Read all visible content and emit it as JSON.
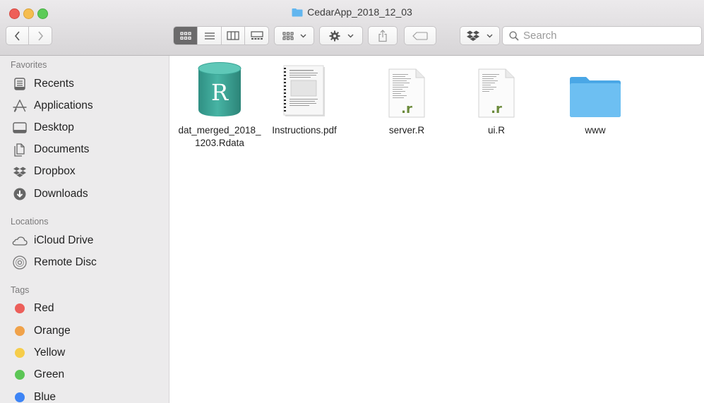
{
  "window": {
    "title": "CedarApp_2018_12_03"
  },
  "toolbar": {
    "search_placeholder": "Search",
    "icons": [
      "chevron-left-icon",
      "chevron-right-icon",
      "icon-view-icon",
      "list-view-icon",
      "column-view-icon",
      "gallery-view-icon",
      "group-by-icon",
      "gear-icon",
      "share-icon",
      "tag-icon",
      "dropbox-icon",
      "search-icon"
    ]
  },
  "sidebar": {
    "favorites_heading": "Favorites",
    "favorites": [
      {
        "label": "Recents",
        "icon": "recents-icon"
      },
      {
        "label": "Applications",
        "icon": "applications-icon"
      },
      {
        "label": "Desktop",
        "icon": "desktop-icon"
      },
      {
        "label": "Documents",
        "icon": "documents-icon"
      },
      {
        "label": "Dropbox",
        "icon": "dropbox-icon"
      },
      {
        "label": "Downloads",
        "icon": "downloads-icon"
      }
    ],
    "locations_heading": "Locations",
    "locations": [
      {
        "label": "iCloud Drive",
        "icon": "cloud-icon"
      },
      {
        "label": "Remote Disc",
        "icon": "disc-icon"
      }
    ],
    "tags_heading": "Tags",
    "tags": [
      {
        "label": "Red",
        "color": "#ec5f5a"
      },
      {
        "label": "Orange",
        "color": "#f0a24a"
      },
      {
        "label": "Yellow",
        "color": "#f6cd4a"
      },
      {
        "label": "Green",
        "color": "#5cc656"
      },
      {
        "label": "Blue",
        "color": "#3d84f5"
      }
    ]
  },
  "files": [
    {
      "name": "dat_merged_2018_1203.Rdata",
      "icon": "rdata-file-icon"
    },
    {
      "name": "Instructions.pdf",
      "icon": "pdf-file-icon"
    },
    {
      "name": "server.R",
      "icon": "r-script-file-icon"
    },
    {
      "name": "ui.R",
      "icon": "r-script-file-icon"
    },
    {
      "name": "www",
      "icon": "folder-icon"
    }
  ],
  "colors": {
    "accent_folder": "#5ab4ee",
    "rdata_teal": "#3aa596",
    "close": "#ee5f58",
    "minimize": "#f5bd4f",
    "zoom": "#5ccb58"
  }
}
